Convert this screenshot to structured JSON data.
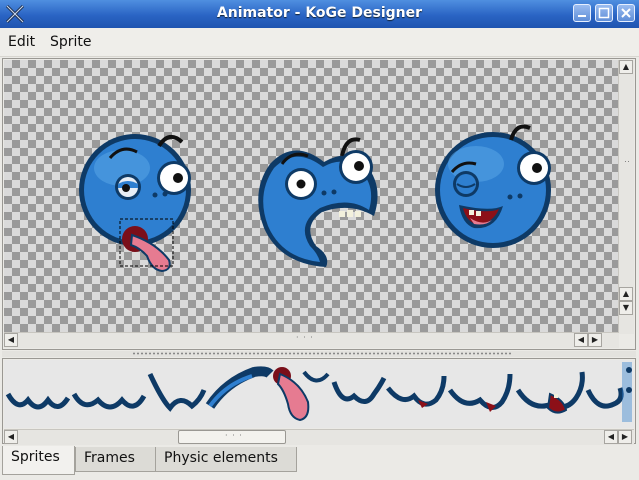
{
  "window": {
    "title": "Animator - KoGe Designer"
  },
  "menu": {
    "items": [
      "Edit",
      "Sprite"
    ]
  },
  "tabs": [
    {
      "label": "Sprites",
      "active": true
    },
    {
      "label": "Frames",
      "active": false
    },
    {
      "label": "Physic elements",
      "active": false
    }
  ],
  "colors": {
    "titlebar": "#2a64c4",
    "sprite_blue": "#2e7fd0",
    "sprite_outline": "#0e3a66",
    "selection": "#000000"
  },
  "icons": [
    "app-x-icon",
    "minimize-icon",
    "maximize-icon",
    "close-icon",
    "arrow-up-icon",
    "arrow-down-icon",
    "arrow-left-icon",
    "arrow-right-icon"
  ]
}
